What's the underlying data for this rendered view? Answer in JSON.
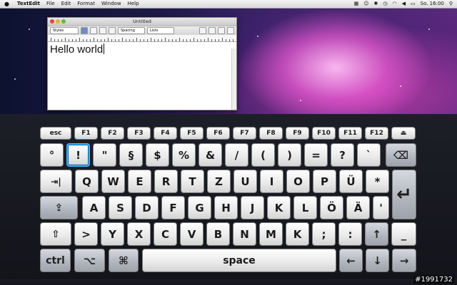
{
  "menubar": {
    "app_name": "TextEdit",
    "menus": [
      "File",
      "Edit",
      "Format",
      "Window",
      "Help"
    ],
    "clock": "So. 16:00"
  },
  "window": {
    "title": "Untitled",
    "toolbar": {
      "styles_label": "Styles",
      "spacing_label": "Spacing",
      "lists_label": "Lists"
    },
    "document_text": "Hello world"
  },
  "keyboard": {
    "function_row": [
      "esc",
      "F1",
      "F2",
      "F3",
      "F4",
      "F5",
      "F6",
      "F7",
      "F8",
      "F9",
      "F10",
      "F11",
      "F12",
      "⏏"
    ],
    "number_row": [
      "°",
      "!",
      "\"",
      "§",
      "$",
      "%",
      "&",
      "/",
      "(",
      ")",
      "=",
      "?",
      "`",
      "⌫"
    ],
    "qwertz_row": [
      "⇥|",
      "Q",
      "W",
      "E",
      "R",
      "T",
      "Z",
      "U",
      "I",
      "O",
      "P",
      "Ü",
      "*"
    ],
    "home_row": [
      "⇪",
      "A",
      "S",
      "D",
      "F",
      "G",
      "H",
      "J",
      "K",
      "L",
      "Ö",
      "Ä",
      "'"
    ],
    "lower_row": [
      "⇧",
      ">",
      "Y",
      "X",
      "C",
      "V",
      "B",
      "N",
      "M",
      "K",
      ";",
      ":",
      "↑",
      "_"
    ],
    "bottom_row": {
      "ctrl": "ctrl",
      "alt": "⌥",
      "cmd": "⌘",
      "space": "space",
      "left": "←",
      "down": "↓",
      "right": "→"
    },
    "return_symbol": "↵",
    "highlighted_key": "!"
  },
  "watermark": "#1991732"
}
